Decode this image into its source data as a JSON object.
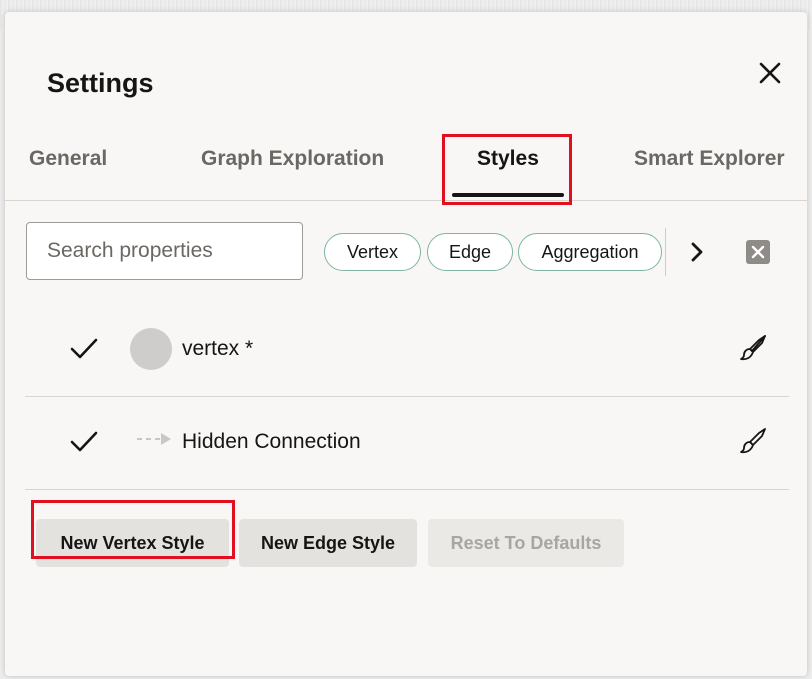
{
  "dialog": {
    "title": "Settings",
    "close_icon": "close-icon"
  },
  "tabs": [
    {
      "label": "General",
      "active": false
    },
    {
      "label": "Graph Exploration",
      "active": false
    },
    {
      "label": "Styles",
      "active": true
    },
    {
      "label": "Smart Explorer",
      "active": false
    }
  ],
  "search": {
    "value": "",
    "placeholder": "Search properties"
  },
  "filters": {
    "chips": [
      "Vertex",
      "Edge",
      "Aggregation"
    ],
    "next_icon": "chevron-right-icon",
    "clear_icon": "clear-filter-icon"
  },
  "styles_list": [
    {
      "checked": true,
      "swatch": "vertex-circle",
      "label": "vertex *",
      "edit_icon": "brush-icon"
    },
    {
      "checked": true,
      "swatch": "edge-dashed-arrow",
      "label": "Hidden Connection",
      "edit_icon": "brush-icon"
    }
  ],
  "actions": {
    "new_vertex_style": "New Vertex Style",
    "new_edge_style": "New Edge Style",
    "reset_to_defaults": "Reset To Defaults"
  },
  "colors": {
    "highlight": "#e0101e",
    "chip_border": "#7fb4a0",
    "vertex_swatch": "#cfcdcb"
  }
}
